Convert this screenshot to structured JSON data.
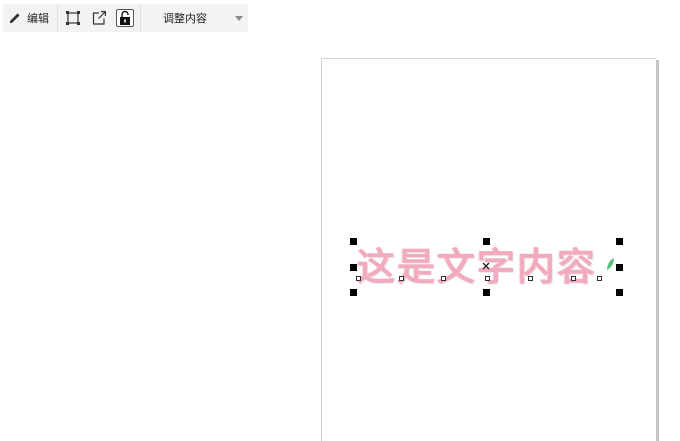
{
  "toolbar": {
    "edit_label": "编辑",
    "adjust_label": "调整内容",
    "icons": [
      "crop-frame-icon",
      "export-icon",
      "lock-icon"
    ]
  },
  "canvas": {
    "text_content": "这是文字内容"
  },
  "colors": {
    "toolbar_bg": "#f3f3f3",
    "text_fill": "#f2aabd",
    "handle": "#000000",
    "page_shadow": "#c4c4c4",
    "accent_green": "#5cc07a"
  }
}
